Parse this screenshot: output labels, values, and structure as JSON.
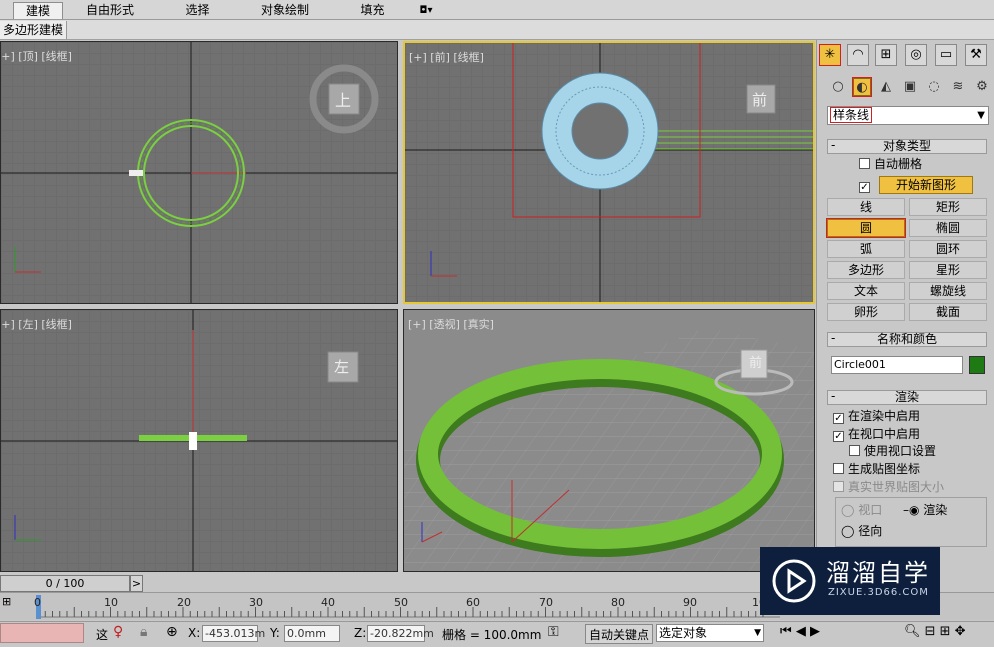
{
  "ribbon": {
    "tabs": [
      "建模",
      "自由形式",
      "选择",
      "对象绘制",
      "填充"
    ],
    "active_tab": "建模",
    "extra_toggle": "◘▾"
  },
  "subtab": {
    "label": "多边形建模"
  },
  "viewports": {
    "top": "[+] [顶] [线框]",
    "front": "[+] [前] [线框]",
    "left": "[+] [左] [线框]",
    "perspective": "[+] [透视] [真实]"
  },
  "viewcube": {
    "top": "上",
    "front": "前",
    "left": "左",
    "persp": "前"
  },
  "command_panel": {
    "tabs": [
      "create-icon",
      "modify-icon",
      "hierarchy-icon",
      "motion-icon",
      "display-icon",
      "utilities-icon"
    ],
    "subcategories": [
      "geometry-icon",
      "shapes-icon",
      "lights-icon",
      "cameras-icon",
      "helpers-icon",
      "spacewarps-icon",
      "systems-icon"
    ],
    "dropdown_value": "样条线",
    "object_type": {
      "header": "对象类型",
      "auto_grid": "自动栅格",
      "start_new_shape": "开始新图形",
      "buttons": [
        "线",
        "矩形",
        "圆",
        "椭圆",
        "弧",
        "圆环",
        "多边形",
        "星形",
        "文本",
        "螺旋线",
        "卵形",
        "截面"
      ],
      "active_button": "圆"
    },
    "name_color": {
      "header": "名称和颜色",
      "name": "Circle001",
      "color": "#1e7a12"
    },
    "rendering": {
      "header": "渲染",
      "enable_in_renderer": "在渲染中启用",
      "enable_in_viewport": "在视口中启用",
      "use_viewport_settings": "使用视口设置",
      "generate_mapping": "生成贴图坐标",
      "real_world_map": "真实世界贴图大小",
      "viewport_radio": "视口",
      "render_radio": "渲染",
      "radial_radio": "径向"
    }
  },
  "timeline": {
    "slider": "0 / 100",
    "next": ">",
    "ticks": [
      "0",
      "10",
      "20",
      "30",
      "40",
      "50",
      "60",
      "70",
      "80",
      "90",
      "10"
    ]
  },
  "status": {
    "x_label": "X:",
    "x_value": "-453.013m",
    "y_label": "Y:",
    "y_value": "0.0mm",
    "z_label": "Z:",
    "z_value": "-20.822mm",
    "grid": "栅格 = 100.0mm",
    "autokey": "自动关键点",
    "selected_object": "选定对象",
    "left_label": "这"
  },
  "watermark": {
    "brand": "溜溜自学",
    "url": "ZIXUE.3D66.COM"
  }
}
